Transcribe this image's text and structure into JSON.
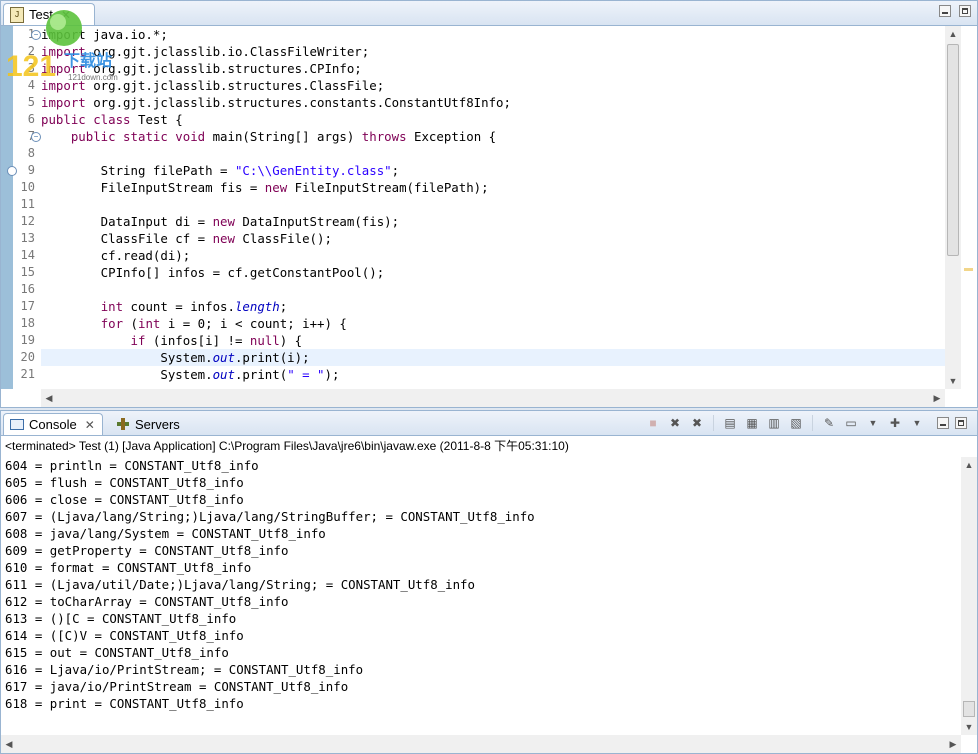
{
  "editor": {
    "tab_label": "Test",
    "tab_icon": "java-file-icon",
    "line_numbers": [
      "1",
      "2",
      "3",
      "4",
      "5",
      "6",
      "7",
      "8",
      "9",
      "10",
      "11",
      "12",
      "13",
      "14",
      "15",
      "16",
      "17",
      "18",
      "19",
      "20",
      "21"
    ],
    "lines": [
      [
        {
          "t": "import java.io.*;",
          "c": "plain"
        }
      ],
      [
        {
          "t": "import ",
          "c": "kw"
        },
        {
          "t": "org.gjt.jclasslib.io.ClassFileWriter;",
          "c": "plain"
        }
      ],
      [
        {
          "t": "import ",
          "c": "kw"
        },
        {
          "t": "org.gjt.jclasslib.structures.CPInfo;",
          "c": "plain"
        }
      ],
      [
        {
          "t": "import ",
          "c": "kw"
        },
        {
          "t": "org.gjt.jclasslib.structures.ClassFile;",
          "c": "plain"
        }
      ],
      [
        {
          "t": "import ",
          "c": "kw"
        },
        {
          "t": "org.gjt.jclasslib.structures.constants.ConstantUtf8Info;",
          "c": "plain"
        }
      ],
      [
        {
          "t": "public class ",
          "c": "kw"
        },
        {
          "t": "Test {",
          "c": "plain"
        }
      ],
      [
        {
          "t": "    ",
          "c": "plain"
        },
        {
          "t": "public static void ",
          "c": "kw"
        },
        {
          "t": "main(String[] args) ",
          "c": "plain"
        },
        {
          "t": "throws ",
          "c": "kw"
        },
        {
          "t": "Exception {",
          "c": "plain"
        }
      ],
      [
        {
          "t": "",
          "c": "plain"
        }
      ],
      [
        {
          "t": "        String filePath = ",
          "c": "plain"
        },
        {
          "t": "\"C:\\\\GenEntity.class\"",
          "c": "str"
        },
        {
          "t": ";",
          "c": "plain"
        }
      ],
      [
        {
          "t": "        FileInputStream fis = ",
          "c": "plain"
        },
        {
          "t": "new ",
          "c": "kw"
        },
        {
          "t": "FileInputStream(filePath);",
          "c": "plain"
        }
      ],
      [
        {
          "t": "",
          "c": "plain"
        }
      ],
      [
        {
          "t": "        DataInput di = ",
          "c": "plain"
        },
        {
          "t": "new ",
          "c": "kw"
        },
        {
          "t": "DataInputStream(fis);",
          "c": "plain"
        }
      ],
      [
        {
          "t": "        ClassFile cf = ",
          "c": "plain"
        },
        {
          "t": "new ",
          "c": "kw"
        },
        {
          "t": "ClassFile();",
          "c": "plain"
        }
      ],
      [
        {
          "t": "        cf.read(di);",
          "c": "plain"
        }
      ],
      [
        {
          "t": "        CPInfo[] infos = cf.getConstantPool();",
          "c": "plain"
        }
      ],
      [
        {
          "t": "",
          "c": "plain"
        }
      ],
      [
        {
          "t": "        ",
          "c": "plain"
        },
        {
          "t": "int ",
          "c": "kw"
        },
        {
          "t": "count = infos.",
          "c": "plain"
        },
        {
          "t": "length",
          "c": "fld"
        },
        {
          "t": ";",
          "c": "plain"
        }
      ],
      [
        {
          "t": "        ",
          "c": "plain"
        },
        {
          "t": "for ",
          "c": "kw"
        },
        {
          "t": "(",
          "c": "plain"
        },
        {
          "t": "int ",
          "c": "kw"
        },
        {
          "t": "i = 0; i < count; i++) {",
          "c": "plain"
        }
      ],
      [
        {
          "t": "            ",
          "c": "plain"
        },
        {
          "t": "if ",
          "c": "kw"
        },
        {
          "t": "(infos[i] != ",
          "c": "plain"
        },
        {
          "t": "null",
          "c": "kw"
        },
        {
          "t": ") {",
          "c": "plain"
        }
      ],
      [
        {
          "t": "                System.",
          "c": "plain"
        },
        {
          "t": "out",
          "c": "fld"
        },
        {
          "t": ".print(i);",
          "c": "plain"
        }
      ],
      [
        {
          "t": "                System.",
          "c": "plain"
        },
        {
          "t": "out",
          "c": "fld"
        },
        {
          "t": ".print(",
          "c": "plain"
        },
        {
          "t": "\" = \"",
          "c": "str"
        },
        {
          "t": ");",
          "c": "plain"
        }
      ]
    ],
    "highlighted_line": 20
  },
  "console": {
    "tab_label": "Console",
    "servers_label": "Servers",
    "status": "<terminated> Test (1) [Java Application] C:\\Program Files\\Java\\jre6\\bin\\javaw.exe (2011-8-8 下午05:31:10)",
    "output": [
      "604 = println = CONSTANT_Utf8_info",
      "605 = flush = CONSTANT_Utf8_info",
      "606 = close = CONSTANT_Utf8_info",
      "607 = (Ljava/lang/String;)Ljava/lang/StringBuffer; = CONSTANT_Utf8_info",
      "608 = java/lang/System = CONSTANT_Utf8_info",
      "609 = getProperty = CONSTANT_Utf8_info",
      "610 = format = CONSTANT_Utf8_info",
      "611 = (Ljava/util/Date;)Ljava/lang/String; = CONSTANT_Utf8_info",
      "612 = toCharArray = CONSTANT_Utf8_info",
      "613 = ()[C = CONSTANT_Utf8_info",
      "614 = ([C)V = CONSTANT_Utf8_info",
      "615 = out = CONSTANT_Utf8_info",
      "616 = Ljava/io/PrintStream; = CONSTANT_Utf8_info",
      "617 = java/io/PrintStream = CONSTANT_Utf8_info",
      "618 = print = CONSTANT_Utf8_info"
    ]
  },
  "watermark": {
    "number": "121",
    "text": "下载站",
    "url": "121down.com"
  },
  "colors": {
    "keyword": "#7f0055",
    "string": "#2a00ff",
    "field": "#0000c0",
    "pane_border": "#99b4d1",
    "current_line": "#e8f2fe"
  }
}
